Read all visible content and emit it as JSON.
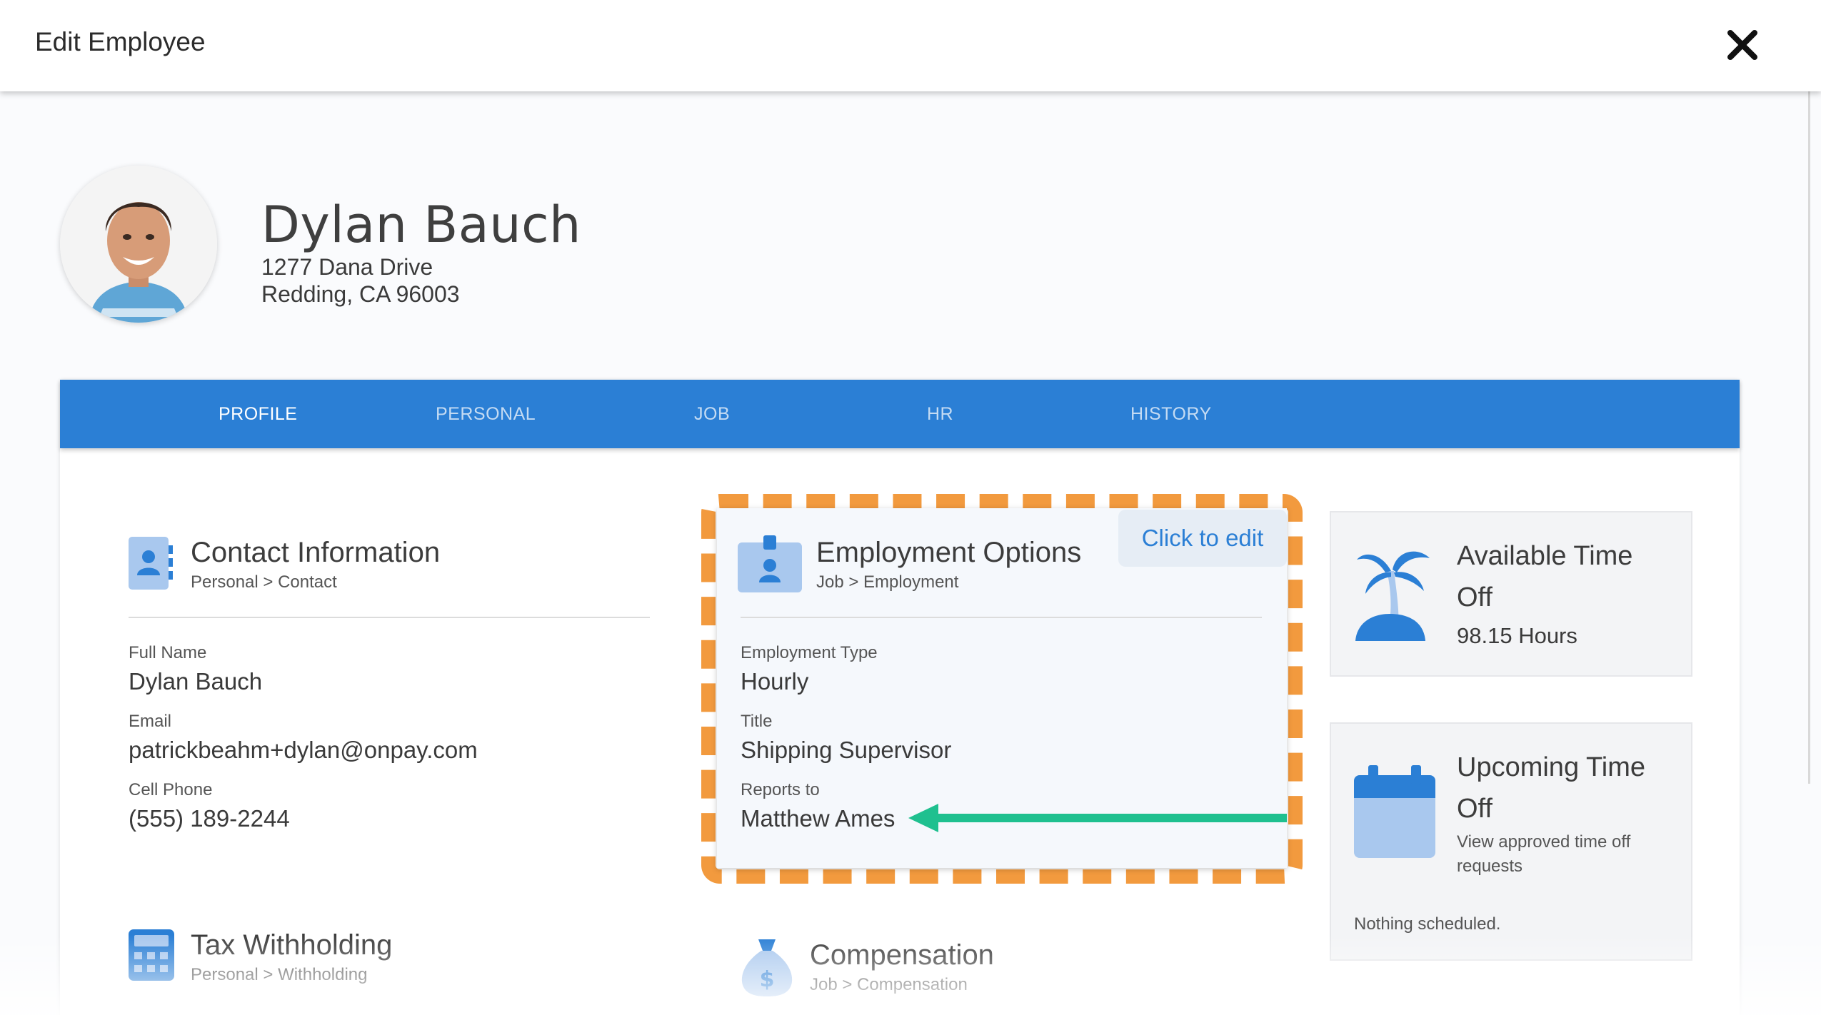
{
  "header": {
    "title": "Edit Employee"
  },
  "employee": {
    "name": "Dylan Bauch",
    "address_line1": "1277 Dana Drive",
    "address_line2": "Redding, CA 96003"
  },
  "tabs": [
    {
      "label": "PROFILE"
    },
    {
      "label": "PERSONAL"
    },
    {
      "label": "JOB"
    },
    {
      "label": "HR"
    },
    {
      "label": "HISTORY"
    }
  ],
  "contact": {
    "title": "Contact Information",
    "subtitle": "Personal > Contact",
    "fields": [
      {
        "label": "Full Name",
        "value": "Dylan Bauch"
      },
      {
        "label": "Email",
        "value": "patrickbeahm+dylan@onpay.com"
      },
      {
        "label": "Cell Phone",
        "value": "(555) 189-2244"
      }
    ]
  },
  "employment": {
    "title": "Employment Options",
    "subtitle": "Job > Employment",
    "edit_label": "Click to edit",
    "fields": [
      {
        "label": "Employment Type",
        "value": "Hourly"
      },
      {
        "label": "Title",
        "value": "Shipping Supervisor"
      },
      {
        "label": "Reports to",
        "value": "Matthew Ames"
      }
    ]
  },
  "tax": {
    "title": "Tax Withholding",
    "subtitle": "Personal > Withholding"
  },
  "compensation": {
    "title": "Compensation",
    "subtitle": "Job > Compensation"
  },
  "available_time_off": {
    "title_line1": "Available Time",
    "title_line2": "Off",
    "hours": "98.15 Hours"
  },
  "upcoming_time_off": {
    "title_line1": "Upcoming Time",
    "title_line2": "Off",
    "desc_line1": "View approved time off",
    "desc_line2": "requests",
    "empty_text": "Nothing scheduled."
  },
  "colors": {
    "brand_blue": "#2b7fd5",
    "highlight_orange": "#f29a3e",
    "arrow_green": "#1fc08f",
    "icon_light_blue": "#a9c8ee"
  },
  "icons": [
    "close-icon",
    "contact-card-icon",
    "id-badge-icon",
    "calculator-icon",
    "money-bag-icon",
    "palm-tree-icon",
    "calendar-icon",
    "arrow-left-icon"
  ]
}
